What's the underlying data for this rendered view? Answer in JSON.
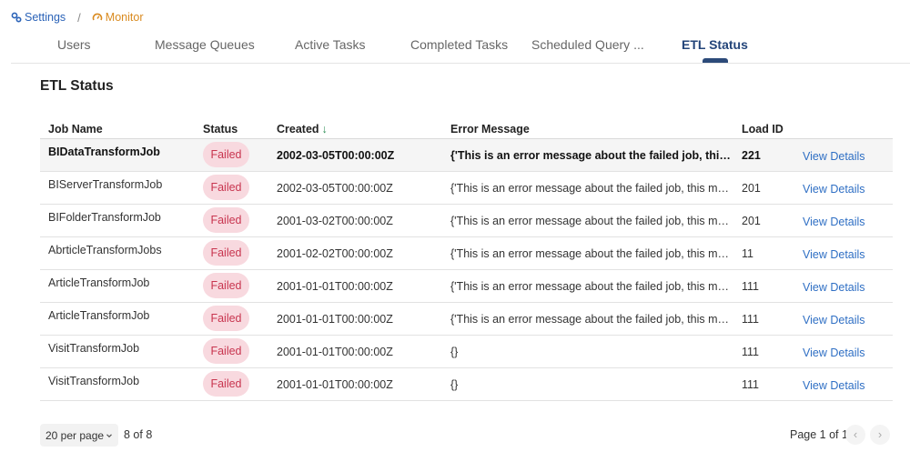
{
  "breadcrumb": {
    "settings": "Settings",
    "separator": "/",
    "monitor": "Monitor"
  },
  "tabs": [
    "Users",
    "Message Queues",
    "Active Tasks",
    "Completed Tasks",
    "Scheduled Query ...",
    "ETL Status"
  ],
  "active_tab": "ETL Status",
  "page_title": "ETL Status",
  "table": {
    "headers": {
      "job_name": "Job Name",
      "status": "Status",
      "created": "Created",
      "created_sort": "↓",
      "error_message": "Error Message",
      "load_id": "Load ID"
    },
    "rows": [
      {
        "job": "BIDataTransformJob",
        "status": "Failed",
        "created": "2002-03-05T00:00:00Z",
        "error": "{'This is an error message about the failed job, this message is truncated",
        "load_id": "221",
        "action": "View Details"
      },
      {
        "job": "BIServerTransformJob",
        "status": "Failed",
        "created": "2002-03-05T00:00:00Z",
        "error": "{'This is an error message about the failed job, this message is truncated",
        "load_id": "201",
        "action": "View Details"
      },
      {
        "job": "BIFolderTransformJob",
        "status": "Failed",
        "created": "2001-03-02T00:00:00Z",
        "error": "{'This is an error message about the failed job, this message is truncated",
        "load_id": "201",
        "action": "View Details"
      },
      {
        "job": "AbrticleTransformJobs",
        "status": "Failed",
        "created": "2001-02-02T00:00:00Z",
        "error": "{'This is an error message about the failed job, this message is truncated",
        "load_id": "11",
        "action": "View Details"
      },
      {
        "job": "ArticleTransformJob",
        "status": "Failed",
        "created": "2001-01-01T00:00:00Z",
        "error": "{'This is an error message about the failed job, this message is truncated",
        "load_id": "111",
        "action": "View Details"
      },
      {
        "job": "ArticleTransformJob",
        "status": "Failed",
        "created": "2001-01-01T00:00:00Z",
        "error": "{'This is an error message about the failed job, this message is truncated",
        "load_id": "111",
        "action": "View Details"
      },
      {
        "job": "VisitTransformJob",
        "status": "Failed",
        "created": "2001-01-01T00:00:00Z",
        "error": "{}",
        "load_id": "111",
        "action": "View Details"
      },
      {
        "job": "VisitTransformJob",
        "status": "Failed",
        "created": "2001-01-01T00:00:00Z",
        "error": "{}",
        "load_id": "111",
        "action": "View Details"
      }
    ]
  },
  "footer": {
    "per_page": "20 per page",
    "count": "8 of 8",
    "page": "Page 1 of 1",
    "prev_icon": "‹",
    "next_icon": "›"
  },
  "colors": {
    "link": "#2f6fc4",
    "badge_bg": "#f8d9df",
    "badge_text": "#c8354f",
    "active_tab": "#24457a",
    "monitor": "#d98a1f",
    "sort_arrow": "#2e8f56"
  },
  "icons": {
    "settings": "gears-icon",
    "monitor": "gauge-icon",
    "per_page_caret": "chevron-down-icon"
  }
}
